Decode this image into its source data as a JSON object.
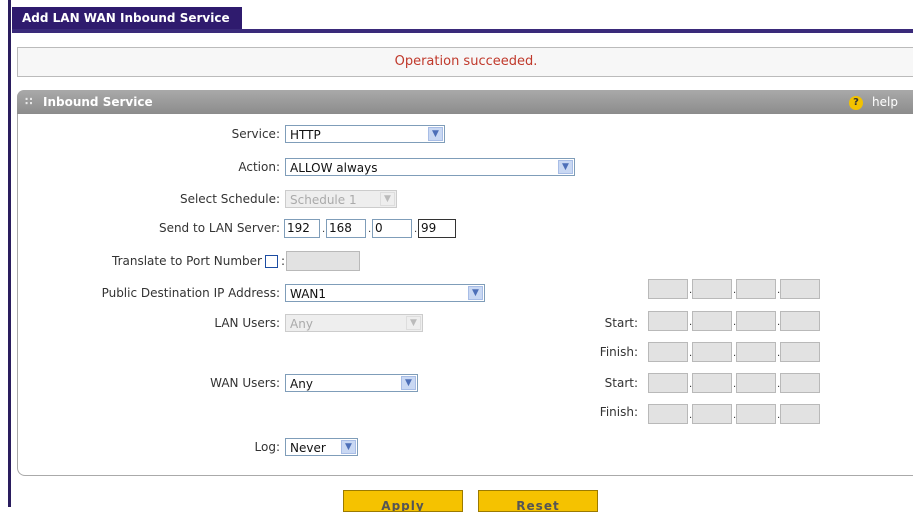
{
  "page": {
    "tab_title": "Add LAN WAN Inbound Service",
    "status_message": "Operation succeeded."
  },
  "panel": {
    "title": "Inbound Service",
    "help_label": "help",
    "help_icon": "?"
  },
  "form": {
    "service_label": "Service:",
    "service_value": "HTTP",
    "action_label": "Action:",
    "action_value": "ALLOW always",
    "schedule_label": "Select Schedule:",
    "schedule_value": "Schedule 1",
    "lan_server_label": "Send to LAN Server:",
    "lan_server_ip": [
      "192",
      "168",
      "0",
      "99"
    ],
    "translate_label": "Translate to Port Number",
    "translate_colon": ":",
    "translate_checked": false,
    "public_dest_label": "Public Destination IP Address:",
    "public_dest_value": "WAN1",
    "lan_users_label": "LAN Users:",
    "lan_users_value": "Any",
    "wan_users_label": "WAN Users:",
    "wan_users_value": "Any",
    "start_label": "Start:",
    "finish_label": "Finish:",
    "log_label": "Log:",
    "log_value": "Never"
  },
  "buttons": {
    "apply": "Apply",
    "reset": "Reset"
  },
  "colors": {
    "tab_bg": "#2f1b6e",
    "status_text": "#c0392b",
    "button_bg": "#f5c200"
  }
}
